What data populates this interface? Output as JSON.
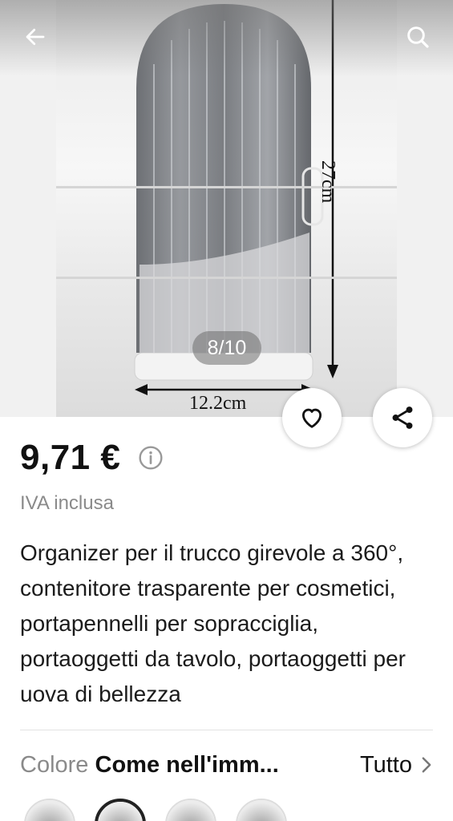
{
  "gallery": {
    "counter": "8/10",
    "dimension_height": "27cm",
    "dimension_width": "12.2cm"
  },
  "nav": {
    "back_icon": "arrow-left-icon",
    "search_icon": "search-icon"
  },
  "actions": {
    "wishlist_icon": "heart-icon",
    "share_icon": "share-icon"
  },
  "product": {
    "price": "9,71 €",
    "vat_note": "IVA inclusa",
    "title": "Organizer per il trucco girevole a 360°, contenitore trasparente per cosmetici, portapennelli per sopracciglia, portaoggetti da tavolo, portaoggetti per uova di bellezza"
  },
  "color": {
    "label": "Colore",
    "value": "Come nell'imm...",
    "all_label": "Tutto"
  },
  "colors": {
    "accent": "#111111",
    "muted_text": "#8a8a8a"
  }
}
